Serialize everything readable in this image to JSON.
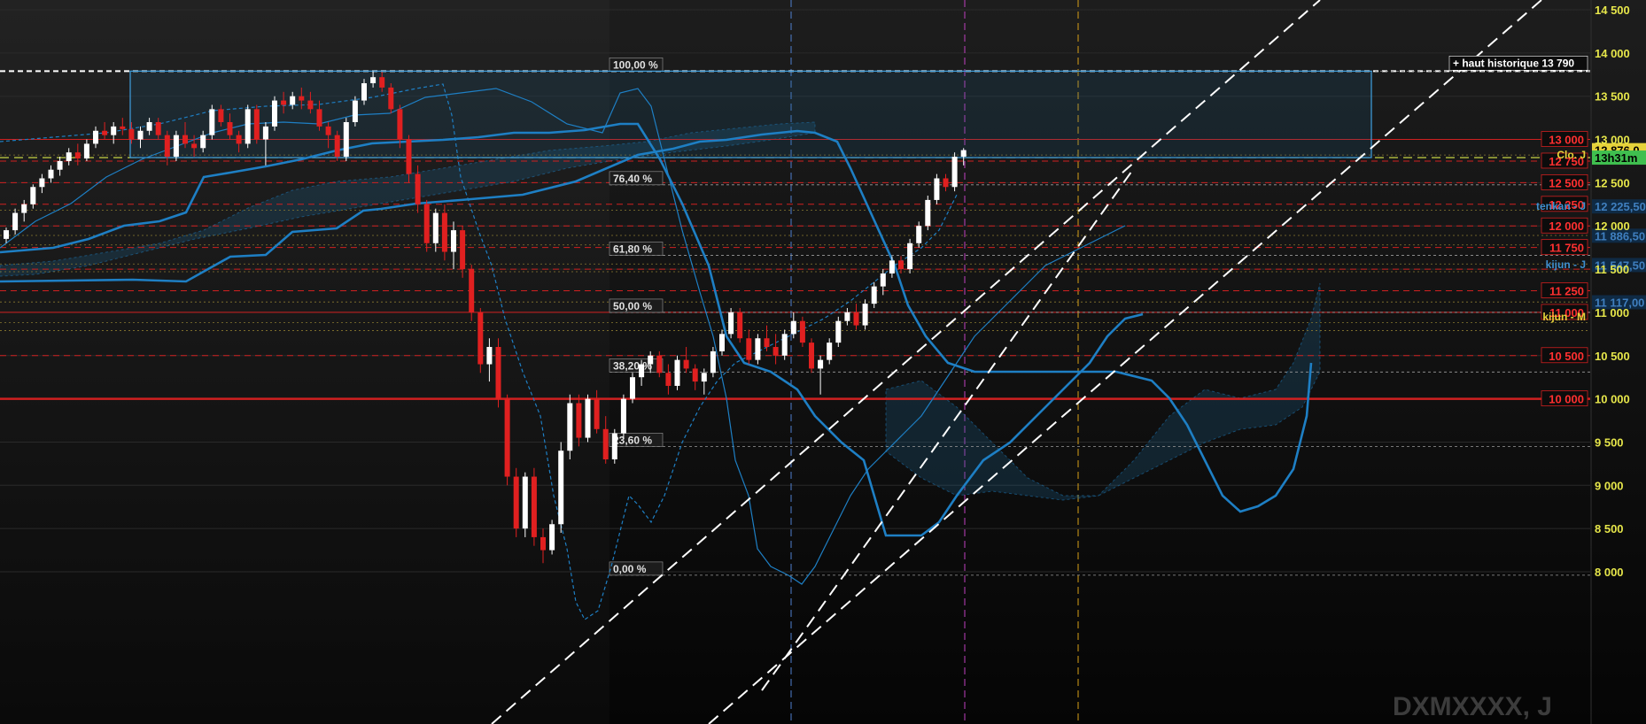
{
  "colors": {
    "background_top": "#1a1a1a",
    "background_bottom": "#050505",
    "axis_text": "#e6e64a",
    "candle_up": "#ffffff",
    "candle_down": "#e02020",
    "ichimoku": "#1e7fc4",
    "cloud": "#1e5f86",
    "support_red": "#d02020",
    "fib_line": "#9a9a9a",
    "trend_channel": "#ffffff",
    "marker_blue": "#4f7fcf",
    "marker_magenta": "#c040c0",
    "marker_orange": "#d8a018",
    "watermark": "#3c3c3c"
  },
  "chart_data": {
    "type": "candlestick",
    "symbol": "DXMXXXX, J",
    "y_axis": {
      "ylim": [
        7700,
        14650
      ],
      "ticks": [
        {
          "value": 14500,
          "label": "14 500"
        },
        {
          "value": 14000,
          "label": "14 000"
        },
        {
          "value": 13500,
          "label": "13 500"
        },
        {
          "value": 13000,
          "label": "13 000"
        },
        {
          "value": 12500,
          "label": "12 500"
        },
        {
          "value": 12000,
          "label": "12 000"
        },
        {
          "value": 11500,
          "label": "11 500"
        },
        {
          "value": 11000,
          "label": "11 000"
        },
        {
          "value": 10500,
          "label": "10 500"
        },
        {
          "value": 10000,
          "label": "10 000"
        },
        {
          "value": 9500,
          "label": "9 500"
        },
        {
          "value": 9000,
          "label": "9 000"
        },
        {
          "value": 8500,
          "label": "8 500"
        },
        {
          "value": 8000,
          "label": "8 000"
        }
      ]
    },
    "historic_high": {
      "value": 13790,
      "label": "+ haut historique 13 790"
    },
    "fibonacci": [
      {
        "pct": "100,00 %",
        "value": 13790
      },
      {
        "pct": "76,40 %",
        "value": 12475
      },
      {
        "pct": "61,80 %",
        "value": 11660
      },
      {
        "pct": "50,00 %",
        "value": 11000
      },
      {
        "pct": "38,20 %",
        "value": 10310
      },
      {
        "pct": "23,60 %",
        "value": 9450
      },
      {
        "pct": "0,00 %",
        "value": 7960
      }
    ],
    "red_levels": [
      {
        "value": 13000,
        "label": "13 000",
        "style": "solid"
      },
      {
        "value": 12750,
        "label": "12 750",
        "style": "dashed"
      },
      {
        "value": 12500,
        "label": "12 500",
        "style": "dashed"
      },
      {
        "value": 12250,
        "label": "12 250",
        "style": "dashed"
      },
      {
        "value": 12000,
        "label": "12 000",
        "style": "dashed"
      },
      {
        "value": 11750,
        "label": "11 750",
        "style": "dashed"
      },
      {
        "value": 11500,
        "label": "",
        "style": "dashed"
      },
      {
        "value": 11250,
        "label": "11 250",
        "style": "dashed"
      },
      {
        "value": 11000,
        "label": "11 000",
        "style": "solid"
      },
      {
        "value": 10500,
        "label": "10 500",
        "style": "dashed"
      },
      {
        "value": 10000,
        "label": "10 000",
        "style": "thick"
      }
    ],
    "price_tags": [
      {
        "value": 12876,
        "label": "12 876,0",
        "bg": "#e6d23a",
        "fg": "#000000"
      },
      {
        "value": 12790,
        "label": "13h31m",
        "bg": "#3fbf4f",
        "fg": "#000000"
      },
      {
        "value": 12225.5,
        "label": "12 225,50",
        "bg": "#0f2a44",
        "fg": "#3f7fbf"
      },
      {
        "value": 11886.5,
        "label": "11 886,50",
        "bg": "#0f2a44",
        "fg": "#3f7fbf"
      },
      {
        "value": 11547.5,
        "label": "11 547,50",
        "bg": "#0f2a44",
        "fg": "#3f7fbf"
      },
      {
        "value": 11117,
        "label": "11 117,00",
        "bg": "#0f2a44",
        "fg": "#3f7fbf"
      }
    ],
    "annotations": [
      {
        "value": 12230,
        "label": "tenkan - J",
        "color": "#3f8fcf"
      },
      {
        "value": 11550,
        "label": "kijun - J",
        "color": "#3f8fcf"
      },
      {
        "value": 10950,
        "label": "kijun - M",
        "color": "#e6d23a"
      },
      {
        "value": 12820,
        "label": "Clo. J",
        "color": "#e6d23a"
      }
    ],
    "ohlc": [
      [
        11850,
        11980,
        11800,
        11950
      ],
      [
        11950,
        12200,
        11900,
        12150
      ],
      [
        12150,
        12300,
        12050,
        12250
      ],
      [
        12250,
        12480,
        12200,
        12450
      ],
      [
        12450,
        12600,
        12380,
        12550
      ],
      [
        12550,
        12700,
        12500,
        12650
      ],
      [
        12650,
        12800,
        12580,
        12750
      ],
      [
        12750,
        12900,
        12700,
        12850
      ],
      [
        12850,
        12950,
        12700,
        12780
      ],
      [
        12780,
        13000,
        12750,
        12950
      ],
      [
        12950,
        13150,
        12900,
        13100
      ],
      [
        13100,
        13200,
        13000,
        13050
      ],
      [
        13050,
        13200,
        12950,
        13150
      ],
      [
        13150,
        13250,
        13050,
        13120
      ],
      [
        13120,
        13200,
        12950,
        13000
      ],
      [
        13000,
        13150,
        12900,
        13100
      ],
      [
        13100,
        13250,
        13050,
        13200
      ],
      [
        13200,
        13250,
        13000,
        13050
      ],
      [
        13050,
        13100,
        12700,
        12800
      ],
      [
        12800,
        13100,
        12750,
        13050
      ],
      [
        13050,
        13200,
        12900,
        12950
      ],
      [
        12950,
        13050,
        12800,
        12900
      ],
      [
        12900,
        13100,
        12850,
        13050
      ],
      [
        13050,
        13400,
        13000,
        13350
      ],
      [
        13350,
        13400,
        13150,
        13200
      ],
      [
        13200,
        13300,
        13000,
        13050
      ],
      [
        13050,
        13100,
        12850,
        12950
      ],
      [
        12950,
        13400,
        12900,
        13350
      ],
      [
        13350,
        13400,
        12950,
        13000
      ],
      [
        13000,
        13200,
        12700,
        13150
      ],
      [
        13150,
        13500,
        13100,
        13450
      ],
      [
        13450,
        13550,
        13300,
        13400
      ],
      [
        13400,
        13550,
        13350,
        13500
      ],
      [
        13500,
        13600,
        13350,
        13450
      ],
      [
        13450,
        13550,
        13300,
        13350
      ],
      [
        13350,
        13450,
        13100,
        13150
      ],
      [
        13150,
        13200,
        12900,
        13050
      ],
      [
        13050,
        13100,
        12750,
        12800
      ],
      [
        12800,
        13250,
        12750,
        13200
      ],
      [
        13200,
        13500,
        13150,
        13450
      ],
      [
        13450,
        13700,
        13400,
        13650
      ],
      [
        13650,
        13790,
        13600,
        13720
      ],
      [
        13720,
        13780,
        13550,
        13600
      ],
      [
        13600,
        13650,
        13300,
        13350
      ],
      [
        13350,
        13400,
        12900,
        13000
      ],
      [
        13000,
        13050,
        12500,
        12600
      ],
      [
        12600,
        12700,
        12150,
        12250
      ],
      [
        12250,
        12300,
        11700,
        11800
      ],
      [
        11800,
        12200,
        11700,
        12150
      ],
      [
        12150,
        12250,
        11600,
        11700
      ],
      [
        11700,
        12050,
        11500,
        11950
      ],
      [
        11950,
        12000,
        11400,
        11500
      ],
      [
        11500,
        11550,
        10900,
        11000
      ],
      [
        11000,
        11050,
        10300,
        10400
      ],
      [
        10400,
        10700,
        10200,
        10600
      ],
      [
        10600,
        10700,
        9900,
        10000
      ],
      [
        10000,
        10050,
        9000,
        9100
      ],
      [
        9100,
        9200,
        8400,
        8500
      ],
      [
        8500,
        9150,
        8400,
        9100
      ],
      [
        9100,
        9200,
        8300,
        8400
      ],
      [
        8400,
        8500,
        8100,
        8250
      ],
      [
        8250,
        8600,
        8200,
        8550
      ],
      [
        8550,
        9500,
        8450,
        9400
      ],
      [
        9400,
        10050,
        9300,
        9950
      ],
      [
        9950,
        10050,
        9450,
        9550
      ],
      [
        9550,
        10050,
        9500,
        10000
      ],
      [
        10000,
        10100,
        9600,
        9650
      ],
      [
        9650,
        9800,
        9250,
        9300
      ],
      [
        9300,
        9650,
        9250,
        9600
      ],
      [
        9600,
        10050,
        9550,
        10000
      ],
      [
        10000,
        10300,
        9950,
        10250
      ],
      [
        10250,
        10450,
        10150,
        10400
      ],
      [
        10400,
        10550,
        10300,
        10500
      ],
      [
        10500,
        10550,
        10250,
        10300
      ],
      [
        10300,
        10400,
        10050,
        10150
      ],
      [
        10150,
        10500,
        10100,
        10450
      ],
      [
        10450,
        10600,
        10300,
        10350
      ],
      [
        10350,
        10400,
        10100,
        10200
      ],
      [
        10200,
        10350,
        10050,
        10300
      ],
      [
        10300,
        10600,
        10250,
        10550
      ],
      [
        10550,
        10800,
        10500,
        10750
      ],
      [
        10750,
        11050,
        10700,
        11000
      ],
      [
        11000,
        11050,
        10650,
        10700
      ],
      [
        10700,
        10800,
        10400,
        10450
      ],
      [
        10450,
        10750,
        10400,
        10700
      ],
      [
        10700,
        10850,
        10550,
        10600
      ],
      [
        10600,
        10750,
        10400,
        10500
      ],
      [
        10500,
        10800,
        10450,
        10750
      ],
      [
        10750,
        11000,
        10700,
        10900
      ],
      [
        10900,
        10950,
        10600,
        10650
      ],
      [
        10650,
        10700,
        10300,
        10350
      ],
      [
        10350,
        10500,
        10050,
        10450
      ],
      [
        10450,
        10700,
        10400,
        10650
      ],
      [
        10650,
        10950,
        10600,
        10900
      ],
      [
        10900,
        11050,
        10850,
        11000
      ],
      [
        11000,
        11100,
        10800,
        10850
      ],
      [
        10850,
        11150,
        10800,
        11100
      ],
      [
        11100,
        11350,
        11050,
        11300
      ],
      [
        11300,
        11500,
        11200,
        11450
      ],
      [
        11450,
        11650,
        11400,
        11600
      ],
      [
        11600,
        11650,
        11450,
        11500
      ],
      [
        11500,
        11850,
        11450,
        11800
      ],
      [
        11800,
        12050,
        11750,
        12000
      ],
      [
        12000,
        12350,
        11950,
        12300
      ],
      [
        12300,
        12600,
        12250,
        12550
      ],
      [
        12550,
        12600,
        12400,
        12450
      ],
      [
        12450,
        12850,
        12400,
        12800
      ],
      [
        12800,
        12900,
        12700,
        12876
      ]
    ],
    "ichimoku_overlay": "tenkan, kijun, chikou and kumo cloud (J and M timeframes)"
  }
}
